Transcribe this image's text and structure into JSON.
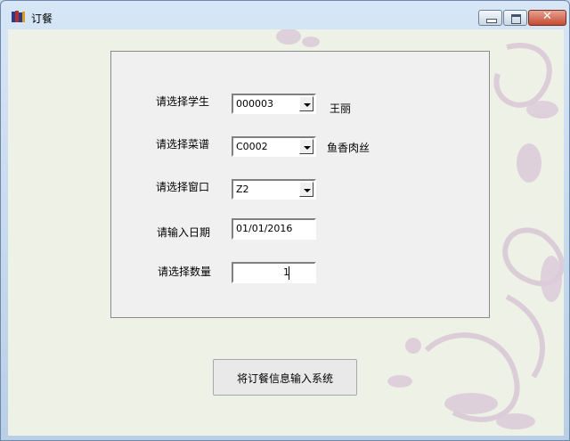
{
  "window": {
    "title": "订餐"
  },
  "form": {
    "student": {
      "label": "请选择学生",
      "value": "000003",
      "name": "王丽"
    },
    "recipe": {
      "label": "请选择菜谱",
      "value": "C0002",
      "name": "鱼香肉丝"
    },
    "window_no": {
      "label": "请选择窗口",
      "value": "Z2"
    },
    "date": {
      "label": "请输入日期",
      "value": "01/01/2016"
    },
    "quantity": {
      "label": "请选择数量",
      "value": "1"
    }
  },
  "submit_label": "将订餐信息输入系统"
}
